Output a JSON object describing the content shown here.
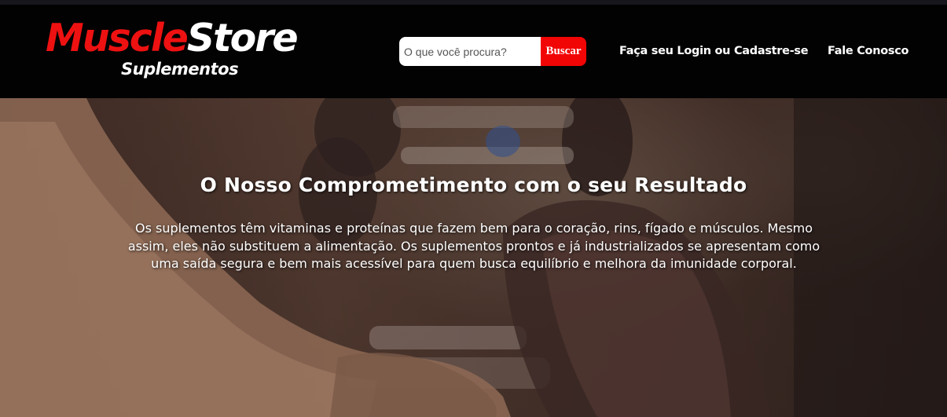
{
  "brand": {
    "name_part1": "Muscle",
    "name_part2": "Store",
    "tagline": "Suplementos"
  },
  "search": {
    "placeholder": "O que você procura?",
    "button_label": "Buscar"
  },
  "nav": {
    "login_label": "Faça seu Login ou Cadastre-se",
    "contact_label": "Fale Conosco"
  },
  "hero": {
    "title": "O Nosso Comprometimento com o seu Resultado",
    "text": "Os suplementos têm vitaminas e proteínas que fazem bem para o coração, rins, fígado e músculos. Mesmo assim, eles não substituem a alimentação. Os suplementos prontos e já industrializados se apresentam como uma saída segura e bem mais acessível para quem busca equilíbrio e melhora da imunidade corporal."
  },
  "colors": {
    "brand_red": "#ee1111",
    "button_red": "#f20505",
    "header_bg": "#020202"
  }
}
